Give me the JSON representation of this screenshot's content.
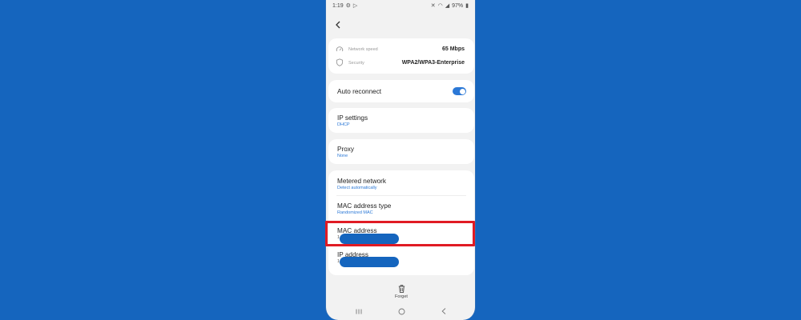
{
  "status_bar": {
    "time": "1:19",
    "battery": "97%"
  },
  "info": {
    "network_speed_label": "Network speed",
    "network_speed_value": "65 Mbps",
    "security_label": "Security",
    "security_value": "WPA2/WPA3-Enterprise"
  },
  "auto_reconnect": {
    "label": "Auto reconnect",
    "enabled": true
  },
  "ip_settings": {
    "label": "IP settings",
    "value": "DHCP"
  },
  "proxy": {
    "label": "Proxy",
    "value": "None"
  },
  "metered_network": {
    "label": "Metered network",
    "value": "Detect automatically"
  },
  "mac_address_type": {
    "label": "MAC address type",
    "value": "Randomized MAC"
  },
  "mac_address": {
    "label": "MAC address",
    "value_prefix": "1"
  },
  "ip_address": {
    "label": "IP address",
    "value_prefix": "1"
  },
  "forget": {
    "label": "Forget"
  },
  "colors": {
    "background": "#1565BE",
    "accent": "#2B78D6",
    "highlight": "#E01B24"
  }
}
